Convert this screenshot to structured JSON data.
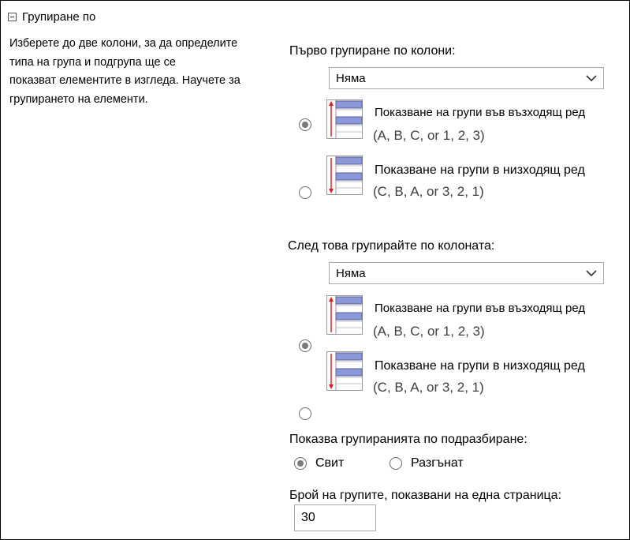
{
  "section": {
    "title": "Групиране по",
    "description_lines": [
      "Изберете до две колони, за да определите",
      "типа на група и подгрупа ще се",
      "показват елементите в изгледа. Научете за",
      "групирането на елементи."
    ]
  },
  "first_group": {
    "label": "Първо групиране по колони:",
    "select_value": "Няма",
    "ascending": {
      "title": "Показване на групи във възходящ ред",
      "example": "(A, B, C, or 1, 2, 3)",
      "selected": true
    },
    "descending": {
      "title": "Показване на групи в низходящ ред",
      "example": "(C, B, A, or 3, 2, 1)",
      "selected": false
    }
  },
  "second_group": {
    "label": "След това групирайте по колоната:",
    "select_value": "Няма",
    "ascending": {
      "title": "Показване на групи във възходящ ред",
      "example": "(A, B, C, or 1, 2, 3)",
      "selected": true
    },
    "descending": {
      "title": "Показване на групи в низходящ ред",
      "example": "(C, B, A, or 3, 2, 1)",
      "selected": false
    }
  },
  "default_display": {
    "label": "Показва групиранията по подразбиране:",
    "collapsed_label": "Свит",
    "expanded_label": "Разгънат",
    "selected": "collapsed"
  },
  "groups_per_page": {
    "label": "Брой на групите, показвани на една страница:",
    "value": "30"
  },
  "colors": {
    "icon_header_fill": "#8c98d9",
    "icon_arrow": "#e02020",
    "border": "#ababab"
  },
  "icons": [
    "collapse-icon",
    "chevron-down-icon",
    "sort-ascending-icon",
    "sort-descending-icon"
  ]
}
